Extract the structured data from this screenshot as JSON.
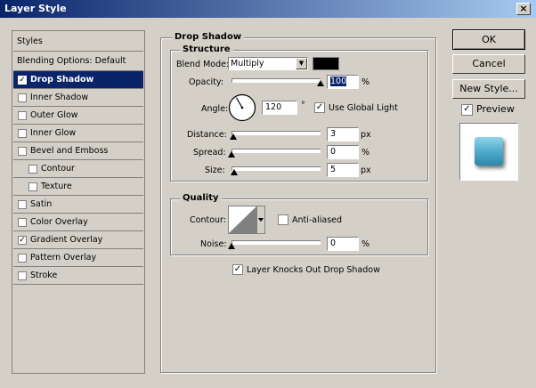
{
  "window": {
    "title": "Layer Style",
    "close_glyph": "×"
  },
  "left_list": {
    "header": "Styles",
    "blending": "Blending Options: Default",
    "items": [
      {
        "label": "Drop Shadow",
        "checked": "✓",
        "selected": true
      },
      {
        "label": "Inner Shadow",
        "checked": ""
      },
      {
        "label": "Outer Glow",
        "checked": ""
      },
      {
        "label": "Inner Glow",
        "checked": ""
      },
      {
        "label": "Bevel and Emboss",
        "checked": ""
      },
      {
        "label": "Contour",
        "checked": ""
      },
      {
        "label": "Texture",
        "checked": ""
      },
      {
        "label": "Satin",
        "checked": ""
      },
      {
        "label": "Color Overlay",
        "checked": ""
      },
      {
        "label": "Gradient Overlay",
        "checked": "✓"
      },
      {
        "label": "Pattern Overlay",
        "checked": ""
      },
      {
        "label": "Stroke",
        "checked": ""
      }
    ]
  },
  "drop_shadow": {
    "title": "Drop Shadow",
    "structure": {
      "title": "Structure",
      "blend_mode_label": "Blend Mode:",
      "blend_mode_value": "Multiply",
      "shadow_color": "#000000",
      "opacity_label": "Opacity:",
      "opacity_value": "100",
      "opacity_fraction": 1.0,
      "percent_unit": "%",
      "angle_label": "Angle:",
      "angle_value": "120",
      "degree_unit": "°",
      "use_global_light_label": "Use Global Light",
      "use_global_light_checked": "✓",
      "distance_label": "Distance:",
      "distance_value": "3",
      "spread_label": "Spread:",
      "spread_value": "0",
      "size_label": "Size:",
      "size_value": "5",
      "px_unit": "px"
    },
    "quality": {
      "title": "Quality",
      "contour_label": "Contour:",
      "anti_aliased_label": "Anti-aliased",
      "anti_aliased_checked": "",
      "noise_label": "Noise:",
      "noise_value": "0",
      "percent_unit": "%"
    },
    "knockout_label": "Layer Knocks Out Drop Shadow",
    "knockout_checked": "✓"
  },
  "buttons": {
    "ok": "OK",
    "cancel": "Cancel",
    "new_style": "New Style..."
  },
  "preview": {
    "label": "Preview",
    "checked": "✓",
    "swatch_color": "#4aa8c8"
  }
}
